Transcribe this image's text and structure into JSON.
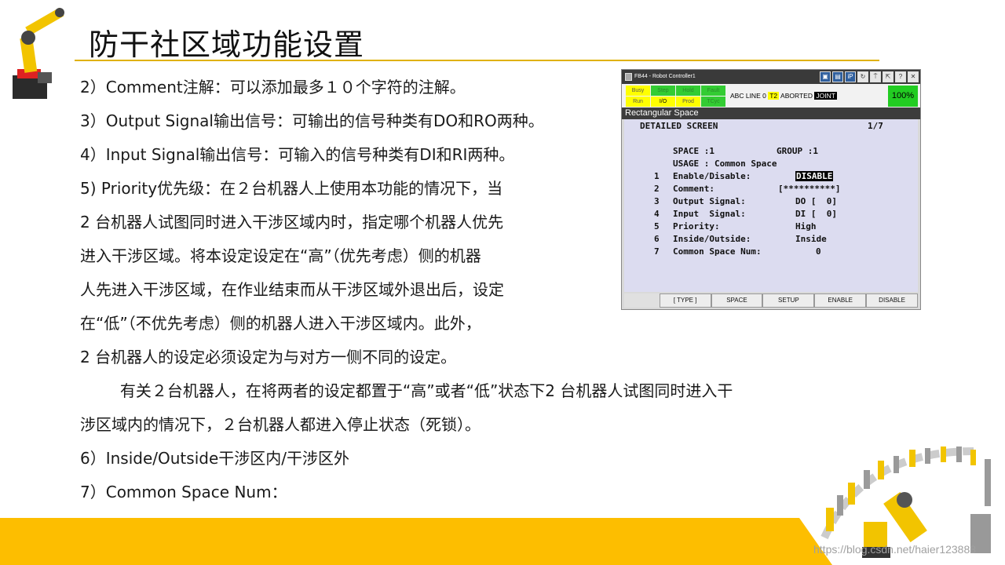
{
  "slide": {
    "title": "防干社区域功能设置",
    "lines": [
      "2）Comment注解：可以添加最多１０个字符的注解。",
      "3）Output Signal输出信号：可输出的信号种类有DO和RO两种。",
      "4）Input Signal输出信号：可输入的信号种类有DI和RI两种。",
      "5)   Priority优先级：在２台机器人上使用本功能的情况下，当",
      " 2 台机器人试图同时进入干涉区域内时，指定哪个机器人优先",
      "进入干涉区域。将本设定设定在“高”（优先考虑）侧的机器",
      "人先进入干涉区域，在作业结束而从干涉区域外退出后，设定",
      "在“低”（不优先考虑）侧的机器人进入干涉区域内。此外，",
      " 2 台机器人的设定必须设定为与对方一侧不同的设定。"
    ],
    "wide_lines": [
      "        有关２台机器人，在将两者的设定都置于“高”或者“低”状态下2 台机器人试图同时进入干",
      "涉区域内的情况下，２台机器人都进入停止状态（死锁）。",
      "6）Inside/Outside干涉区内/干涉区外",
      "7）Common Space Num："
    ],
    "watermark": "https://blog.csdn.net/haier123888"
  },
  "pendant": {
    "window_title": "FB44 - Robot Controller1",
    "toolbar_icons": [
      "monitor-icon",
      "keyboard-icon",
      "ip-icon",
      "refresh-icon",
      "tool-icon",
      "resize-icon",
      "help-icon",
      "close-icon"
    ],
    "toolbar_labels": [
      "▣",
      "▤",
      "iP",
      "↻",
      "⍑",
      "⇱",
      "?",
      "✕"
    ],
    "lamps": {
      "busy": "Busy",
      "step": "Step",
      "hold": "Hold",
      "fault": "Fault",
      "run": "Run",
      "io": "I/O",
      "prod": "Prod",
      "tcyc": "TCyc"
    },
    "status_prefix": "ABC LINE 0",
    "status_mode": "T2",
    "status_state": "ABORTED",
    "status_joint": "JOINT",
    "override": "100%",
    "screen_name": "Rectangular Space",
    "screen_title": "DETAILED SCREEN",
    "page": "1/7",
    "space_label": "SPACE :1",
    "group_label": "GROUP :1",
    "usage_label": "USAGE : Common Space",
    "items": [
      {
        "num": "1",
        "label": "Enable/Disable:",
        "value": "DISABLE"
      },
      {
        "num": "2",
        "label": "Comment:",
        "value": "[**********]"
      },
      {
        "num": "3",
        "label": "Output Signal:",
        "value": "DO [  0]"
      },
      {
        "num": "4",
        "label": "Input  Signal:",
        "value": "DI [  0]"
      },
      {
        "num": "5",
        "label": "Priority:",
        "value": "High"
      },
      {
        "num": "6",
        "label": "Inside/Outside:",
        "value": "Inside"
      },
      {
        "num": "7",
        "label": "Common Space Num:",
        "value": "0"
      }
    ],
    "fkeys": [
      "[ TYPE ]",
      "SPACE",
      "SETUP",
      "ENABLE",
      "DISABLE"
    ]
  },
  "colors": {
    "accent_yellow": "#FDBE00",
    "rule": "#e0b100",
    "pendant_body": "#dcdcf0"
  }
}
